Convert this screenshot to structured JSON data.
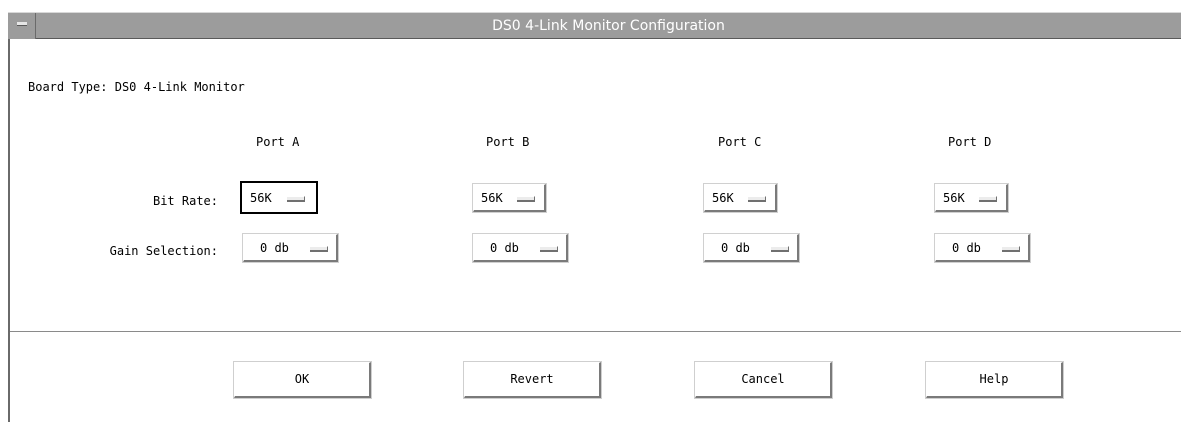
{
  "window": {
    "title": "DS0 4-Link Monitor Configuration"
  },
  "board": {
    "label": "Board Type:",
    "value": "DS0 4-Link Monitor"
  },
  "row_labels": {
    "bit_rate": "Bit Rate:",
    "gain": "Gain Selection:"
  },
  "ports": [
    {
      "label": "Port A",
      "bit_rate": "56K",
      "gain": "0 db"
    },
    {
      "label": "Port B",
      "bit_rate": "56K",
      "gain": "0 db"
    },
    {
      "label": "Port C",
      "bit_rate": "56K",
      "gain": "0 db"
    },
    {
      "label": "Port D",
      "bit_rate": "56K",
      "gain": "0 db"
    }
  ],
  "buttons": {
    "ok": "OK",
    "revert": "Revert",
    "cancel": "Cancel",
    "help": "Help"
  }
}
